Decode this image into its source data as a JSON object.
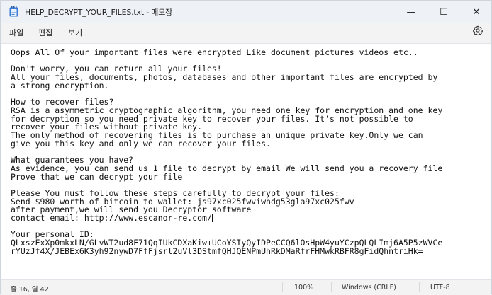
{
  "window": {
    "title": "HELP_DECRYPT_YOUR_FILES.txt - 메모장",
    "controls": {
      "minimize": "—",
      "maximize": "☐",
      "close": "✕"
    }
  },
  "menu": {
    "file": "파일",
    "edit": "편집",
    "view": "보기"
  },
  "icons": {
    "app": "notepad-icon",
    "settings": "gear-icon"
  },
  "editor": {
    "lines": [
      "Oops All Of your important files were encrypted Like document pictures videos etc..",
      "",
      "Don't worry, you can return all your files!",
      "All your files, documents, photos, databases and other important files are encrypted by",
      "a strong encryption.",
      "",
      "How to recover files?",
      "RSA is a asymmetric cryptographic algorithm, you need one key for encryption and one key",
      "for decryption so you need private key to recover your files. It's not possible to",
      "recover your files without private key.",
      "The only method of recovering files is to purchase an unique private key.Only we can",
      "give you this key and only we can recover your files.",
      "",
      "What guarantees you have?",
      "As evidence, you can send us 1 file to decrypt by email We will send you a recovery file",
      "Prove that we can decrypt your file",
      "",
      "Please You must follow these steps carefully to decrypt your files:",
      "Send $980 worth of bitcoin to wallet: js97xc025fwviwhdg53gla97xc025fwv",
      "after payment,we will send you Decryptor software",
      "contact email: http://www.escanor-re.com/",
      "",
      "Your personal ID:",
      "QLxszExXp0mkxLN/GLvWT2ud8F71QqIUkCDXaKiw+UCoYSIyQyIDPeCCQ6lOsHpW4yuYCzpQLQLImj6A5P5zWVCe",
      "rYUzJf4X/JEBEx6K3yh92nywD7FfFjsrl2uVl3DStmfQHJQENPmUhRkDMaRfrFHMwkRBFR8gFidQhntriHk="
    ]
  },
  "status": {
    "position": "줄 16, 열 42",
    "zoom": "100%",
    "line_ending": "Windows (CRLF)",
    "encoding": "UTF-8"
  }
}
